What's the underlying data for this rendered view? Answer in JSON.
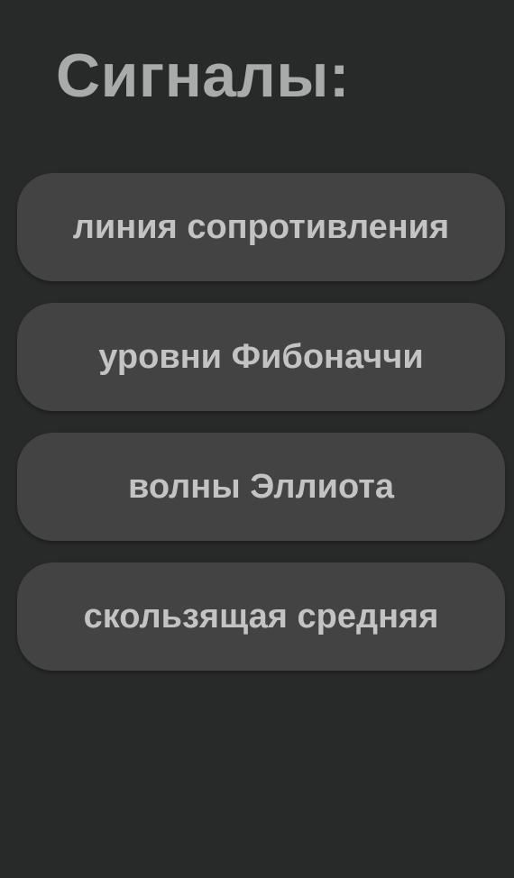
{
  "header": {
    "title": "Сигналы:"
  },
  "signals": [
    {
      "label": "линия сопротивления"
    },
    {
      "label": "уровни Фибоначчи"
    },
    {
      "label": "волны Эллиота"
    },
    {
      "label": "скользящая средняя"
    }
  ],
  "colors": {
    "background": "#282a29",
    "button": "#434343",
    "title_text": "#a9abaa",
    "button_text": "#c2c3c2"
  }
}
